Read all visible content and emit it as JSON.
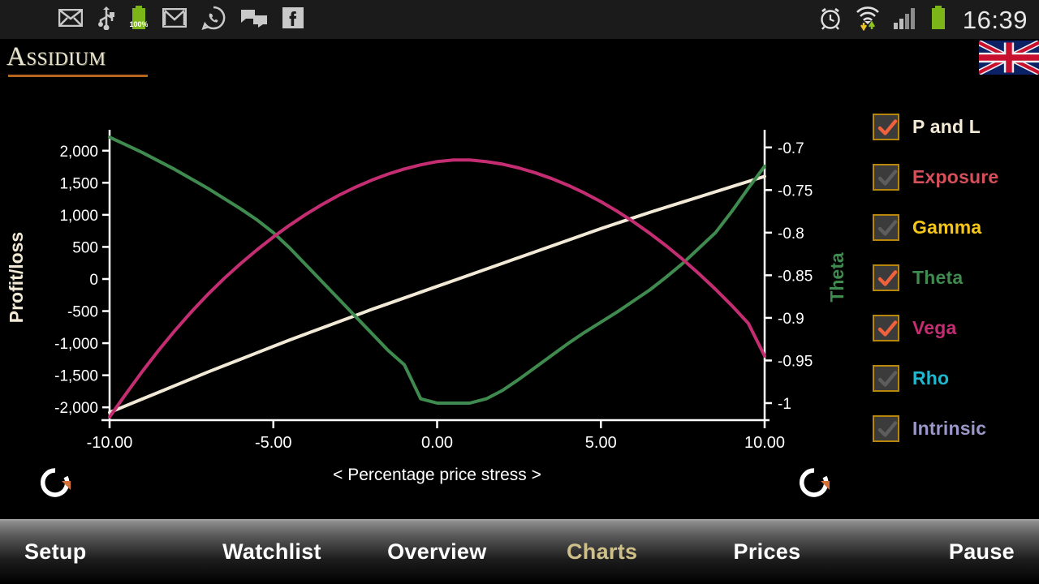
{
  "statusbar": {
    "time": "16:39",
    "battery_text": "100%",
    "left_icons": [
      "envelope-icon",
      "usb-icon",
      "battery-icon",
      "gmail-icon",
      "whatsapp-icon",
      "messages-icon",
      "facebook-icon"
    ],
    "right_icons": [
      "alarm-clock-icon",
      "wifi-transfer-icon",
      "signal-bars-icon",
      "battery-icon"
    ]
  },
  "header": {
    "logo_text": "Assidium",
    "flag": "uk-flag-icon"
  },
  "chart_data": {
    "type": "line",
    "title": "",
    "xlabel": "< Percentage price stress >",
    "ylabel": "Profit/loss",
    "y2label": "Theta",
    "xlim": [
      -10,
      10
    ],
    "ylim": [
      -2200,
      2250
    ],
    "y2lim": [
      -1.02,
      -0.685
    ],
    "xticks": [
      "-10.00",
      "-5.00",
      "0.00",
      "5.00",
      "10.00"
    ],
    "xtick_values": [
      -10,
      -5,
      0,
      5,
      10
    ],
    "yticks": [
      "2,000",
      "1,500",
      "1,000",
      "500",
      "0",
      "-500",
      "-1,000",
      "-1,500",
      "-2,000"
    ],
    "ytick_values": [
      2000,
      1500,
      1000,
      500,
      0,
      -500,
      -1000,
      -1500,
      -2000
    ],
    "y2ticks": [
      "-0.7",
      "-0.75",
      "-0.8",
      "-0.85",
      "-0.9",
      "-0.95",
      "-1"
    ],
    "y2tick_values": [
      -0.7,
      -0.75,
      -0.8,
      -0.85,
      -0.9,
      -0.95,
      -1.0
    ],
    "grid": false,
    "legend_position": "right",
    "x": [
      -10,
      -9.5,
      -9,
      -8.5,
      -8,
      -7.5,
      -7,
      -6.5,
      -6,
      -5.5,
      -5,
      -4.5,
      -4,
      -3.5,
      -3,
      -2.5,
      -2,
      -1.5,
      -1,
      -0.5,
      0,
      0.5,
      1,
      1.5,
      2,
      2.5,
      3,
      3.5,
      4,
      4.5,
      5,
      5.5,
      6,
      6.5,
      7,
      7.5,
      8,
      8.5,
      9,
      9.5,
      10
    ],
    "series": [
      {
        "name": "P and L",
        "color": "#f2ead6",
        "axis": "left",
        "values": [
          -2080,
          -1975,
          -1870,
          -1765,
          -1660,
          -1555,
          -1450,
          -1350,
          -1250,
          -1150,
          -1050,
          -950,
          -855,
          -760,
          -665,
          -570,
          -475,
          -385,
          -295,
          -205,
          -115,
          -25,
          65,
          155,
          245,
          335,
          425,
          515,
          605,
          695,
          785,
          870,
          955,
          1040,
          1120,
          1200,
          1280,
          1360,
          1440,
          1520,
          1600
        ]
      },
      {
        "name": "Theta",
        "color": "#3f8a4e",
        "axis": "right",
        "values": [
          -0.688,
          -0.697,
          -0.706,
          -0.716,
          -0.726,
          -0.737,
          -0.748,
          -0.76,
          -0.772,
          -0.785,
          -0.8,
          -0.818,
          -0.838,
          -0.858,
          -0.878,
          -0.898,
          -0.918,
          -0.938,
          -0.955,
          -0.995,
          -1.0,
          -1.0,
          -1.0,
          -0.995,
          -0.985,
          -0.972,
          -0.958,
          -0.944,
          -0.93,
          -0.917,
          -0.905,
          -0.893,
          -0.88,
          -0.867,
          -0.852,
          -0.836,
          -0.818,
          -0.8,
          -0.775,
          -0.748,
          -0.722
        ]
      },
      {
        "name": "Vega",
        "color": "#c42d72",
        "axis": "left",
        "values": [
          -2150,
          -1790,
          -1440,
          -1110,
          -800,
          -510,
          -240,
          10,
          240,
          455,
          655,
          840,
          1010,
          1165,
          1305,
          1430,
          1540,
          1635,
          1715,
          1780,
          1830,
          1855,
          1855,
          1830,
          1790,
          1730,
          1655,
          1565,
          1460,
          1340,
          1205,
          1055,
          890,
          710,
          515,
          305,
          80,
          -160,
          -415,
          -690,
          -1200
        ]
      }
    ]
  },
  "legend": {
    "items": [
      {
        "label": "P and L",
        "color": "#f2ead6",
        "checked": true
      },
      {
        "label": "Exposure",
        "color": "#d4505a",
        "checked": false
      },
      {
        "label": "Gamma",
        "color": "#f5c518",
        "checked": false
      },
      {
        "label": "Theta",
        "color": "#3f8a4e",
        "checked": true
      },
      {
        "label": "Vega",
        "color": "#c42d72",
        "checked": true
      },
      {
        "label": "Rho",
        "color": "#20b8cf",
        "checked": false
      },
      {
        "label": "Intrinsic",
        "color": "#9a97c9",
        "checked": false
      }
    ]
  },
  "controls": {
    "rotate_left": "rotate-left-button",
    "rotate_right": "rotate-right-button"
  },
  "navbar": {
    "items": [
      {
        "label": "Setup",
        "active": false
      },
      {
        "label": "Watchlist",
        "active": false
      },
      {
        "label": "Overview",
        "active": false
      },
      {
        "label": "Charts",
        "active": true
      },
      {
        "label": "Prices",
        "active": false
      },
      {
        "label": "Pause",
        "active": false
      }
    ]
  }
}
